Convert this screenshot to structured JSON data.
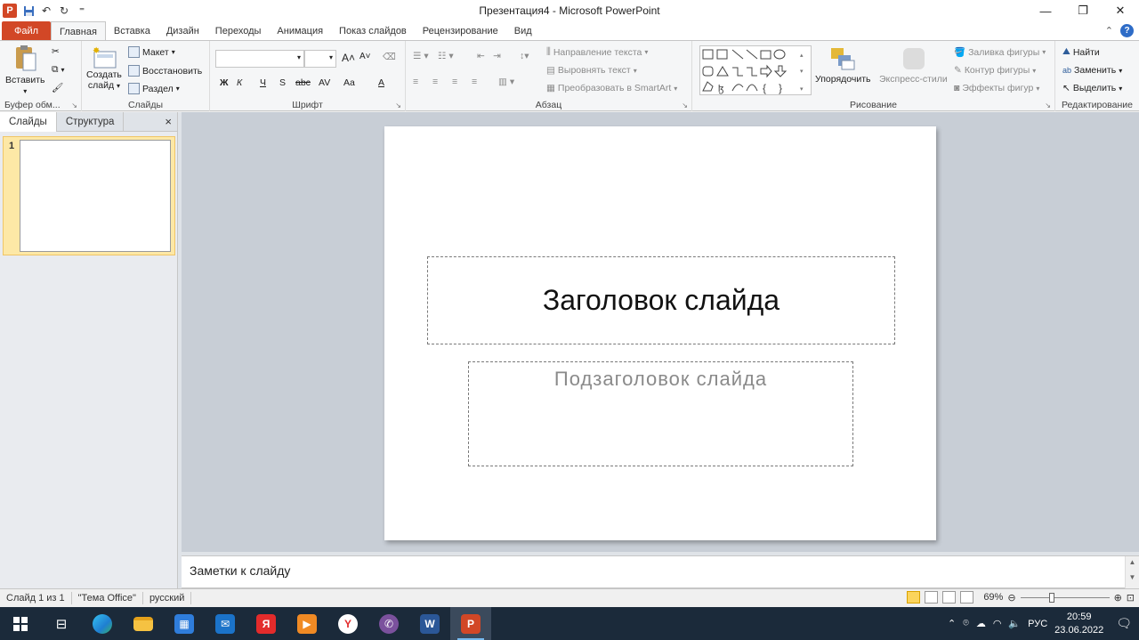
{
  "window": {
    "title": "Презентация4  -  Microsoft PowerPoint",
    "quick_access": [
      "save-icon",
      "undo-icon",
      "redo-icon",
      "customize-icon"
    ]
  },
  "tabs": {
    "file": "Файл",
    "items": [
      "Главная",
      "Вставка",
      "Дизайн",
      "Переходы",
      "Анимация",
      "Показ слайдов",
      "Рецензирование",
      "Вид"
    ],
    "active": "Главная"
  },
  "ribbon": {
    "clipboard": {
      "paste": "Вставить",
      "label": "Буфер обм..."
    },
    "slides": {
      "new_slide_1": "Создать",
      "new_slide_2": "слайд",
      "layout": "Макет",
      "reset": "Восстановить",
      "section": "Раздел",
      "label": "Слайды"
    },
    "font": {
      "label": "Шрифт",
      "bold": "Ж",
      "italic": "К",
      "underline": "Ч",
      "strike": "S",
      "abc": "abc",
      "spacing": "AV",
      "case": "Aa",
      "color": "A"
    },
    "paragraph": {
      "text_direction": "Направление текста",
      "align_text": "Выровнять текст",
      "smartart": "Преобразовать в SmartArt",
      "label": "Абзац"
    },
    "drawing": {
      "arrange": "Упорядочить",
      "quick_styles": "Экспресс-стили",
      "fill": "Заливка фигуры",
      "outline": "Контур фигуры",
      "effects": "Эффекты фигур",
      "label": "Рисование"
    },
    "editing": {
      "find": "Найти",
      "replace": "Заменить",
      "select": "Выделить",
      "label": "Редактирование"
    }
  },
  "left_pane": {
    "tab_slides": "Слайды",
    "tab_outline": "Структура",
    "close": "×",
    "slide_number": "1"
  },
  "slide": {
    "title_placeholder": "Заголовок слайда",
    "subtitle_placeholder": "Подзаголовок слайда"
  },
  "notes": {
    "placeholder": "Заметки к слайду"
  },
  "status_bar": {
    "slide_info": "Слайд 1 из 1",
    "theme": "\"Тема Office\"",
    "language": "русский",
    "zoom": "69%",
    "zoom_fraction": 0.69
  },
  "taskbar": {
    "apps": [
      "windows-start",
      "task-view",
      "edge",
      "file-explorer",
      "store",
      "mail",
      "yandex",
      "media-player",
      "yandex-browser",
      "viber",
      "word",
      "powerpoint"
    ],
    "language": "РУС",
    "time": "20:59",
    "date": "23.06.2022"
  },
  "colors": {
    "file_tab": "#d24726",
    "taskbar": "#1b2a3a",
    "thumb_select": "#fde8a6"
  }
}
